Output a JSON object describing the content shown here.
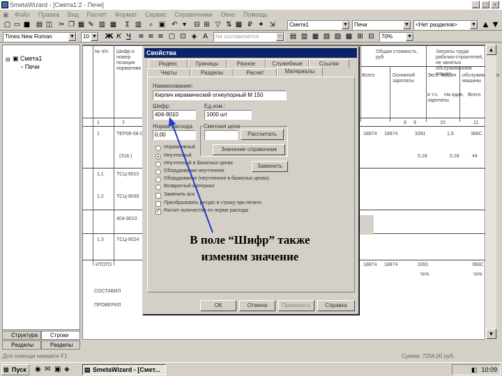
{
  "window": {
    "title": "SmetaWizard - [Смета1:2 - Печи]",
    "min": "_",
    "max": "□",
    "close": "×"
  },
  "menu": [
    "Файл",
    "Правка",
    "Вид",
    "Расчет",
    "Формат",
    "Сервис",
    "Справочники",
    "Окно",
    "Помощь"
  ],
  "toolbar1": {
    "combo1": "Смета1",
    "combo2": "Печи",
    "combo3": "<Нет разделов>"
  },
  "toolbar2": {
    "font": "Times New Roman",
    "size": "10",
    "bold": "Ж",
    "italic": "К",
    "underline": "Ч",
    "style": "Не составляется",
    "zoom": "70%"
  },
  "tree": {
    "root": "Смета1",
    "child": "Печи"
  },
  "left_tabs": [
    "Структура",
    "Строки",
    "Разделы",
    "Разделы"
  ],
  "doc": {
    "hdr_col1": "№ п/п",
    "hdr_col2": "Шифр и номер позиции норматива",
    "hdr_cost": "Общая стоимость, руб",
    "hdr_labor": "Затраты труда рабочих-строителей, не занятых обслуживанием машин",
    "sub1": "Всего",
    "sub2": "Основной зарплаты",
    "sub3": "Эксп. машин",
    "sub3b": "в т.ч. зарплаты",
    "sub4": "обслуживающих машины",
    "sub4a": "На един.",
    "sub4b": "Всего",
    "col_nums": [
      "1",
      "2",
      "8",
      "9",
      "10",
      "11"
    ],
    "row1_num": "1",
    "row1_code": "ТЕР08-08-003-4",
    "row1_vals": [
      "18874",
      "3391",
      "1,9",
      "366С"
    ],
    "row2_code": "(318.)",
    "row2_vals": [
      "0,18",
      "44"
    ],
    "row3_num": "1,1",
    "row3_code": "ТСЦ-9010",
    "row4_num": "1,2",
    "row4_code": "ТСЦ-9030",
    "row5_code": "404-9010",
    "row6_num": "1,3",
    "row6_code": "ТСЦ-9024",
    "total_label": "ИТОГО",
    "total_vals": [
      "18874",
      "3391",
      "366С"
    ],
    "total_pct": "%%",
    "sostavil": "СОСТАВИЛ",
    "proveril": "ПРОВЕРИЛ"
  },
  "dialog": {
    "title": "Свойства",
    "tabs_back": [
      "Индекс",
      "Границы",
      "Разное",
      "Служебные",
      "Ссылки"
    ],
    "tabs_front": [
      "Черты",
      "Разделы",
      "Расчет",
      "Материалы"
    ],
    "name_label": "Наименование:",
    "name_value": "Кирпич керамический огнеупорный М 150",
    "cipher_label": "Шифр:",
    "cipher_value": "404-9010",
    "unit_label": "Ед.изм.:",
    "unit_value": "1000 шт",
    "norm_label": "Норма расхода",
    "norm_value": "0,00",
    "price_label": "Сметная цена",
    "calc_button": "Рассчитать",
    "cost_button": "Значение справочник",
    "replace_button": "Заменить",
    "options": [
      "Нормативный",
      "Неучтенный",
      "Неучтенный в базисных ценах",
      "Оборудование неучтенное",
      "Оборудование (неучтенное в базисных ценах)",
      "Возвратный материал",
      "Заменить все",
      "Преобразовать ресурс в строку при печати",
      "Расчет количества по норме расхода"
    ],
    "ok": "ОК",
    "cancel": "Отмена",
    "apply": "Применить",
    "help": "Справка"
  },
  "callout": {
    "line1": "В поле “Шифр” также",
    "line2": "изменим значение"
  },
  "status": {
    "left": "Для помощи нажмите F1",
    "right": "Сумма: 7204,00 руб."
  },
  "taskbar": {
    "start": "Пуск",
    "task": "SmetaWizard - [Смет...",
    "time": "10:09"
  },
  "colors": {
    "title_active": "#0a246a",
    "arrow": "#1a3cc8"
  }
}
